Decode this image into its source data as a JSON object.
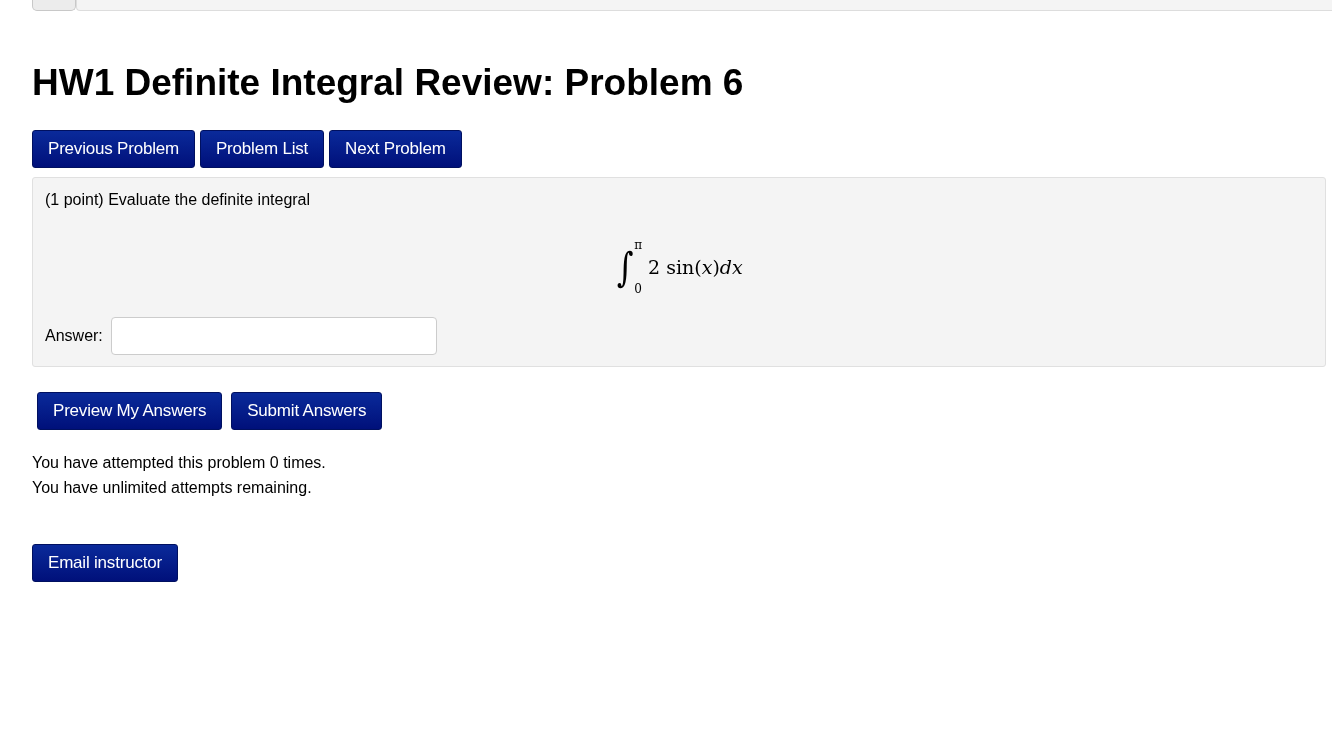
{
  "title": "HW1 Definite Integral Review: Problem 6",
  "nav_buttons": [
    "Previous Problem",
    "Problem List",
    "Next Problem"
  ],
  "problem": {
    "intro": "(1 point) Evaluate the definite integral",
    "math": {
      "symbol": "∫",
      "upper": "π",
      "lower": "0",
      "integrand": "2 sin(*x*)*dx*"
    },
    "answer_label": "Answer:"
  },
  "action_buttons": [
    "Preview My Answers",
    "Submit Answers"
  ],
  "attempts": [
    "You have attempted this problem 0 times.",
    "You have unlimited attempts remaining."
  ],
  "footer_buttons": [
    "Email instructor"
  ]
}
